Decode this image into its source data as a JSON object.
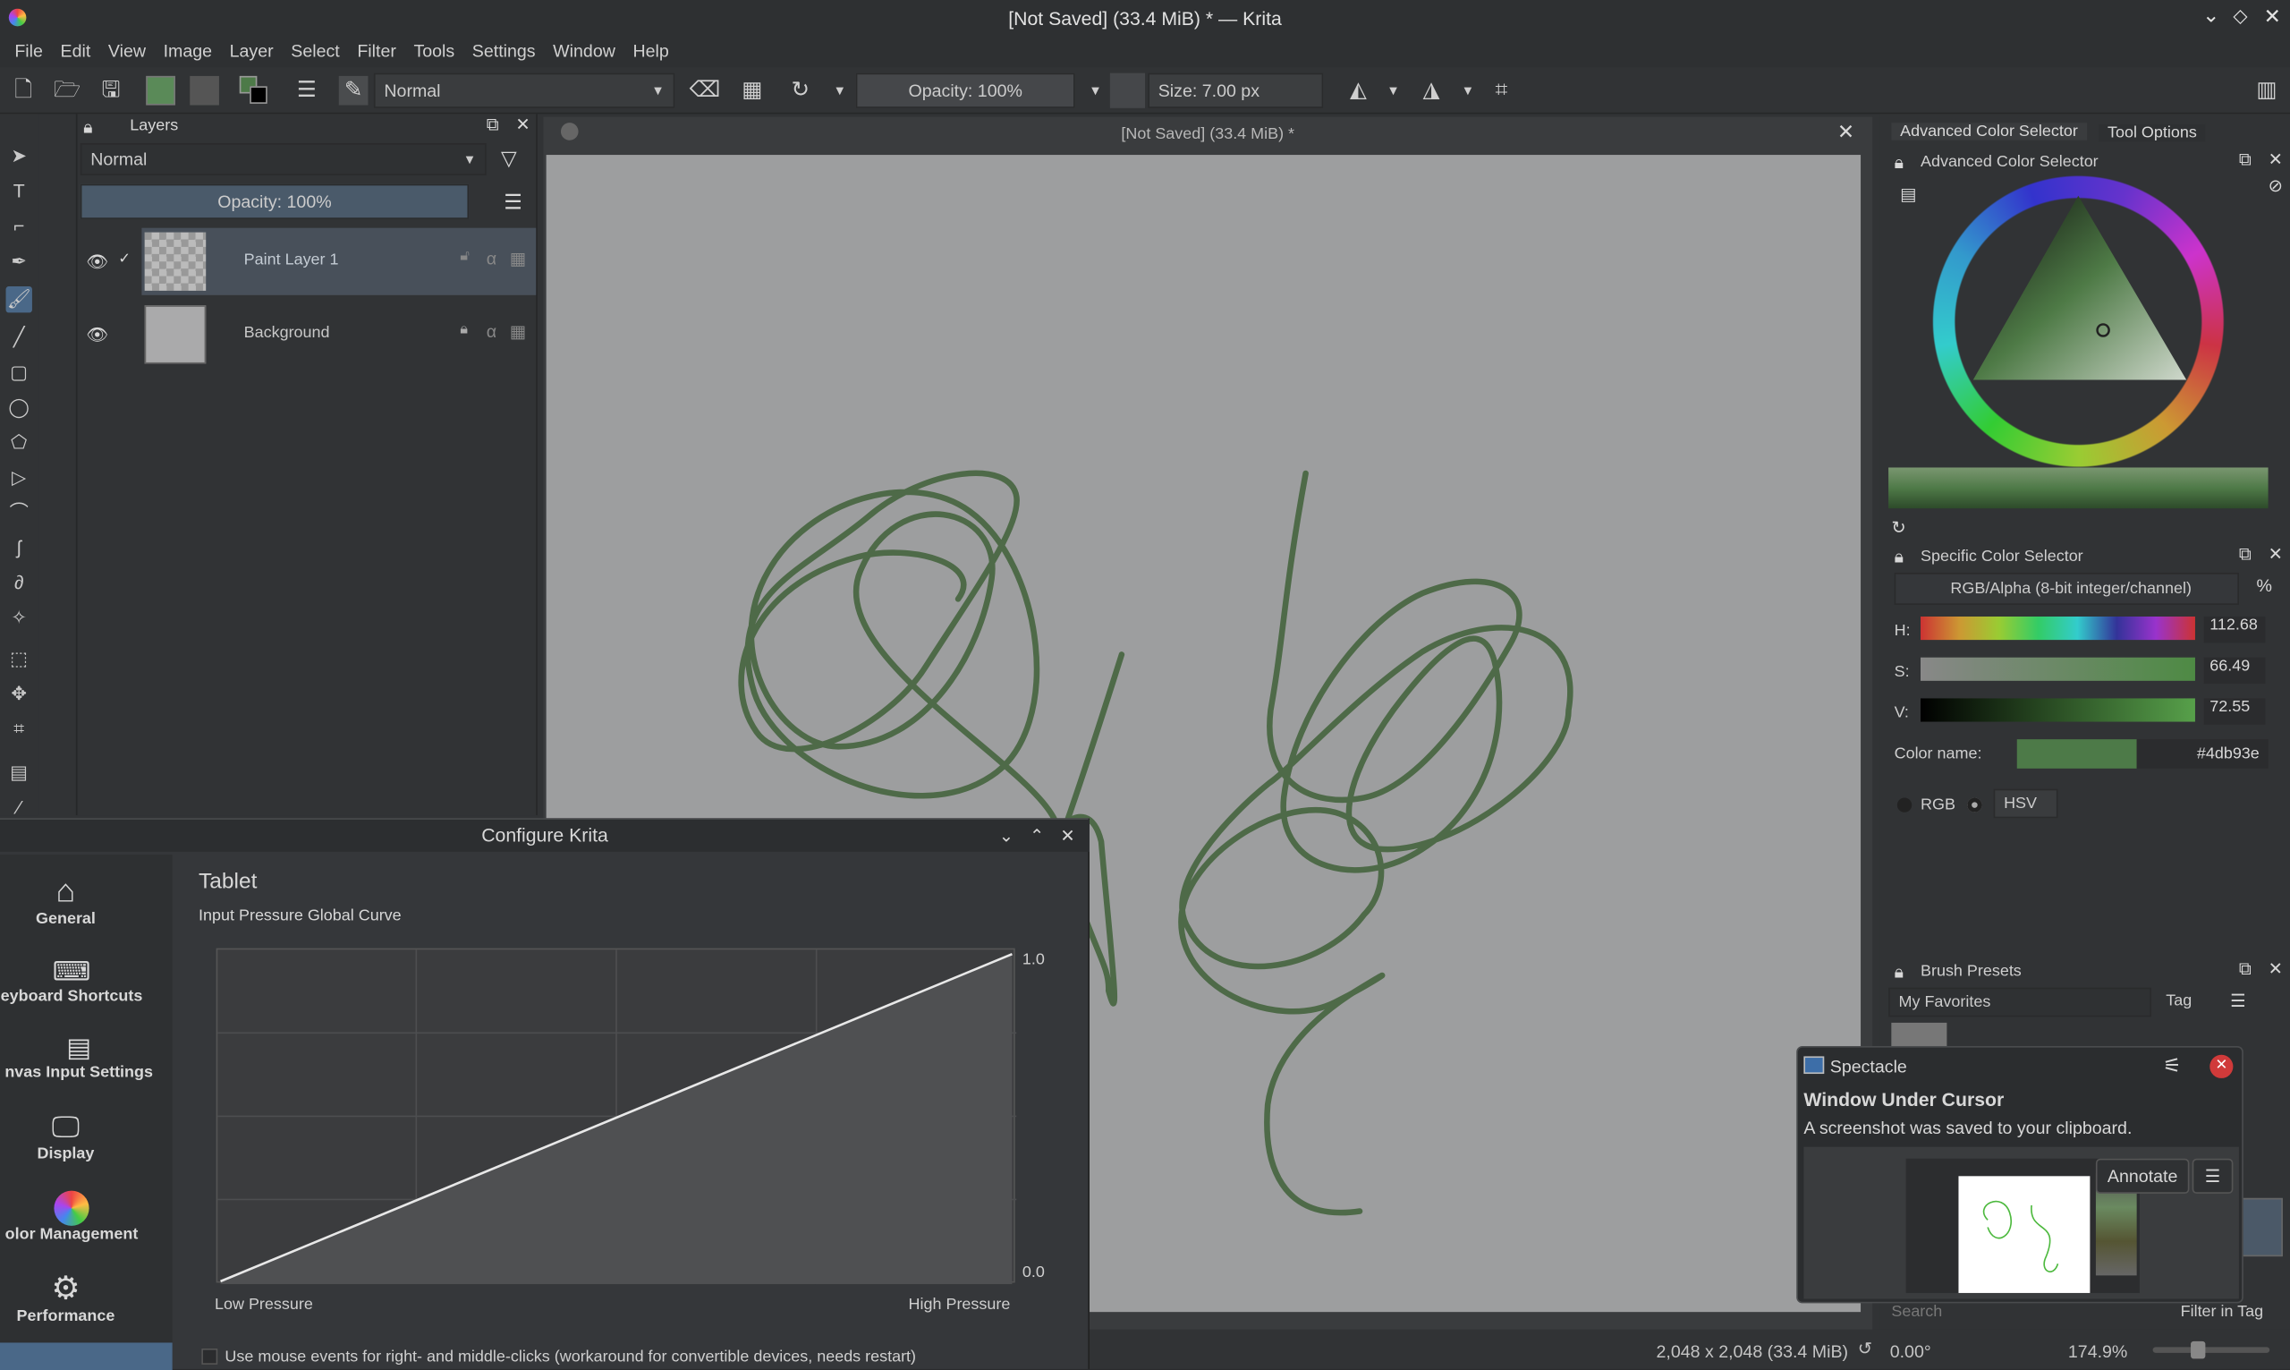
{
  "window": {
    "title": "[Not Saved] (33.4 MiB) * — Krita"
  },
  "menu": [
    "File",
    "Edit",
    "View",
    "Image",
    "Layer",
    "Select",
    "Filter",
    "Tools",
    "Settings",
    "Window",
    "Help"
  ],
  "toolbar": {
    "blend_mode": "Normal",
    "opacity": "Opacity: 100%",
    "size": "Size: 7.00 px"
  },
  "layers": {
    "title": "Layers",
    "blend_mode": "Normal",
    "opacity": "Opacity:  100%",
    "items": [
      {
        "name": "Paint Layer 1"
      },
      {
        "name": "Background"
      }
    ]
  },
  "document_tab": {
    "title": "[Not Saved]  (33.4 MiB) *"
  },
  "right": {
    "tabs": [
      "Advanced Color Selector",
      "Tool Options"
    ],
    "adv_title": "Advanced Color Selector",
    "specific_title": "Specific Color Selector",
    "color_model": "RGB/Alpha (8-bit integer/channel)",
    "percent": "%",
    "h_label": "H:",
    "h_value": "112.68",
    "s_label": "S:",
    "s_value": "66.49",
    "v_label": "V:",
    "v_value": "72.55",
    "color_name_label": "Color name:",
    "color_hex": "#4db93e",
    "swatch_color": "#4d7a48",
    "rgb": "RGB",
    "hsv": "HSV",
    "brush_title": "Brush Presets",
    "favorites": "My Favorites",
    "tag": "Tag",
    "search": "Search",
    "filter_tag": "Filter in Tag"
  },
  "dialog": {
    "title": "Configure Krita",
    "nav": [
      {
        "label": "General"
      },
      {
        "label": "eyboard Shortcuts"
      },
      {
        "label": "nvas Input Settings"
      },
      {
        "label": "Display"
      },
      {
        "label": "olor Management"
      },
      {
        "label": "Performance"
      }
    ],
    "section": "Tablet",
    "subtitle": "Input Pressure Global Curve",
    "y_max": "1.0",
    "y_min": "0.0",
    "x_low": "Low Pressure",
    "x_high": "High Pressure",
    "checkbox_label": "Use mouse events for right- and middle-clicks (workaround for convertible devices, needs restart)"
  },
  "notification": {
    "app": "Spectacle",
    "title": "Window Under Cursor",
    "body": "A screenshot was saved to your clipboard.",
    "annotate": "Annotate"
  },
  "status": {
    "dimensions": "2,048 x 2,048 (33.4 MiB)",
    "rotation": "0.00°",
    "zoom": "174.9%"
  },
  "stroke_color": "#4e6a48"
}
